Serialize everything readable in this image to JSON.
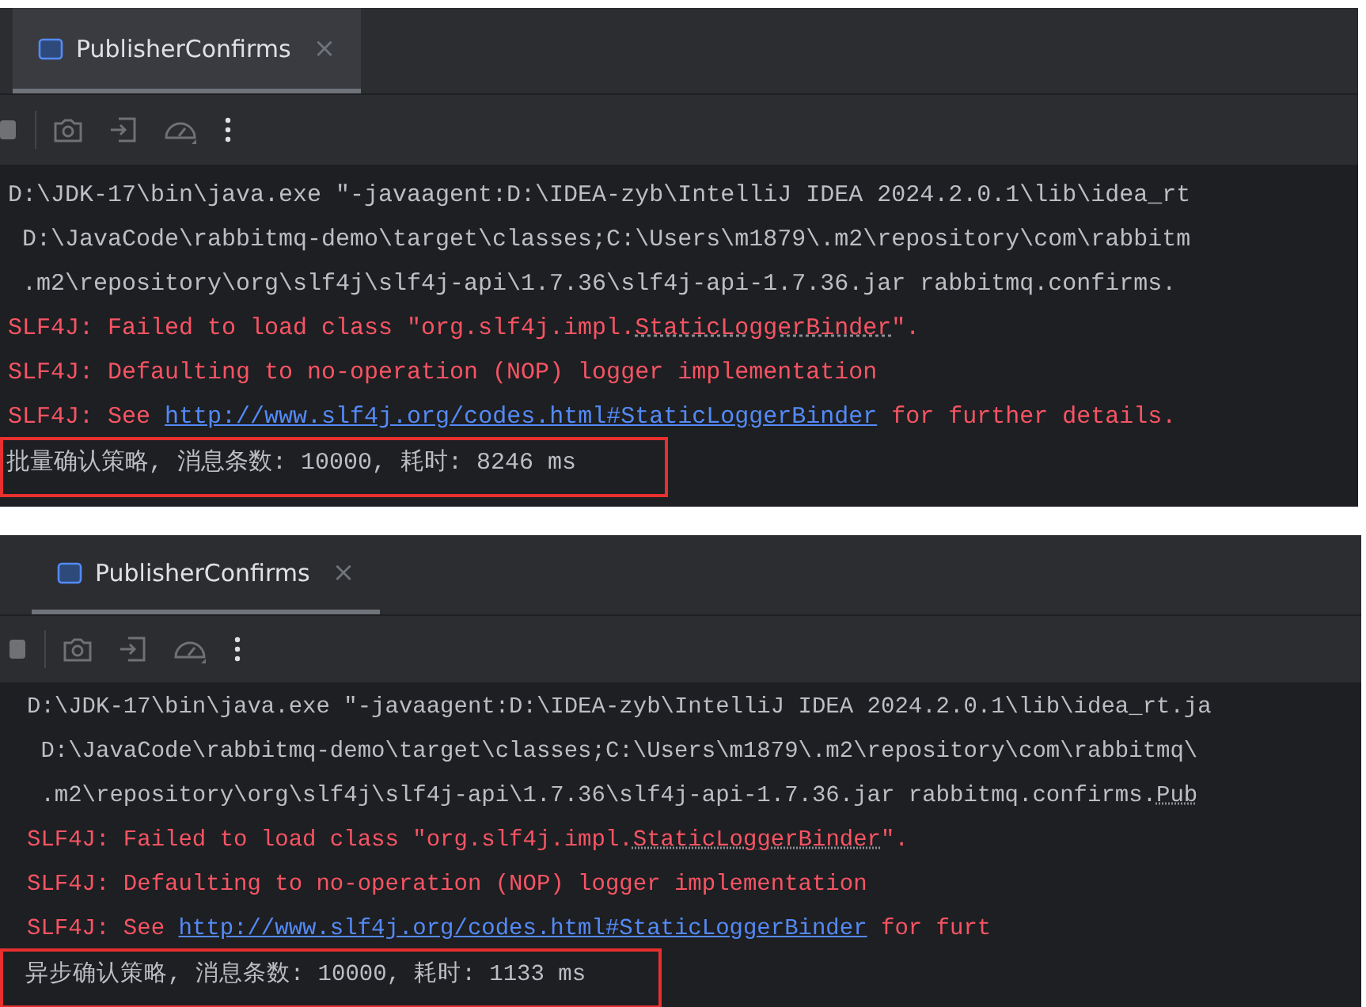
{
  "panels": [
    {
      "tab": {
        "label": "PublisherConfirms",
        "close": "×",
        "selected": true
      },
      "console": [
        {
          "kind": "normal",
          "segments": [
            {
              "kind": "plain",
              "text": "D:\\JDK-17\\bin\\java.exe \"-javaagent:D:\\IDEA-zyb\\IntelliJ IDEA 2024.2.0.1\\lib\\idea_rt"
            }
          ]
        },
        {
          "kind": "normal",
          "segments": [
            {
              "kind": "plain",
              "text": " D:\\JavaCode\\rabbitmq-demo\\target\\classes;C:\\Users\\m1879\\.m2\\repository\\com\\rabbitm"
            }
          ]
        },
        {
          "kind": "normal",
          "segments": [
            {
              "kind": "plain",
              "text": " .m2\\repository\\org\\slf4j\\slf4j-api\\1.7.36\\slf4j-api-1.7.36.jar rabbitmq.confirms."
            }
          ]
        },
        {
          "kind": "error",
          "segments": [
            {
              "kind": "plain",
              "text": "SLF4J: Failed to load class \"org.slf4j.impl."
            },
            {
              "kind": "hint",
              "text": "StaticLoggerBinder"
            },
            {
              "kind": "plain",
              "text": "\"."
            }
          ]
        },
        {
          "kind": "error",
          "segments": [
            {
              "kind": "plain",
              "text": "SLF4J: Defaulting to no-operation (NOP) logger implementation"
            }
          ]
        },
        {
          "kind": "error",
          "segments": [
            {
              "kind": "plain",
              "text": "SLF4J: See "
            },
            {
              "kind": "link",
              "text": "http://www.slf4j.org/codes.html#StaticLoggerBinder"
            },
            {
              "kind": "plain",
              "text": " for further details."
            }
          ]
        },
        {
          "kind": "result",
          "highlighted": true,
          "segments": [
            {
              "kind": "plain",
              "text": "批量确认策略, 消息条数: 10000, 耗时: 8246 ms"
            }
          ]
        }
      ]
    },
    {
      "tab": {
        "label": "PublisherConfirms",
        "close": "×",
        "selected": true
      },
      "console": [
        {
          "kind": "normal",
          "segments": [
            {
              "kind": "plain",
              "text": "D:\\JDK-17\\bin\\java.exe \"-javaagent:D:\\IDEA-zyb\\IntelliJ IDEA 2024.2.0.1\\lib\\idea_rt.ja"
            }
          ]
        },
        {
          "kind": "normal",
          "segments": [
            {
              "kind": "plain",
              "text": " D:\\JavaCode\\rabbitmq-demo\\target\\classes;C:\\Users\\m1879\\.m2\\repository\\com\\rabbitmq\\"
            }
          ]
        },
        {
          "kind": "normal",
          "segments": [
            {
              "kind": "plain",
              "text": " .m2\\repository\\org\\slf4j\\slf4j-api\\1.7.36\\slf4j-api-1.7.36.jar rabbitmq.confirms."
            },
            {
              "kind": "hint",
              "text": "Pub"
            }
          ]
        },
        {
          "kind": "error",
          "segments": [
            {
              "kind": "plain",
              "text": "SLF4J: Failed to load class \"org.slf4j.impl."
            },
            {
              "kind": "hint",
              "text": "StaticLoggerBinder"
            },
            {
              "kind": "plain",
              "text": "\"."
            }
          ]
        },
        {
          "kind": "error",
          "segments": [
            {
              "kind": "plain",
              "text": "SLF4J: Defaulting to no-operation (NOP) logger implementation"
            }
          ]
        },
        {
          "kind": "error",
          "segments": [
            {
              "kind": "plain",
              "text": "SLF4J: See "
            },
            {
              "kind": "link",
              "text": "http://www.slf4j.org/codes.html#StaticLoggerBinder"
            },
            {
              "kind": "plain",
              "text": " for furt"
            }
          ]
        },
        {
          "kind": "result",
          "highlighted": true,
          "segments": [
            {
              "kind": "plain",
              "text": "异步确认策略, 消息条数: 10000, 耗时: 1133 ms"
            }
          ]
        }
      ]
    }
  ]
}
